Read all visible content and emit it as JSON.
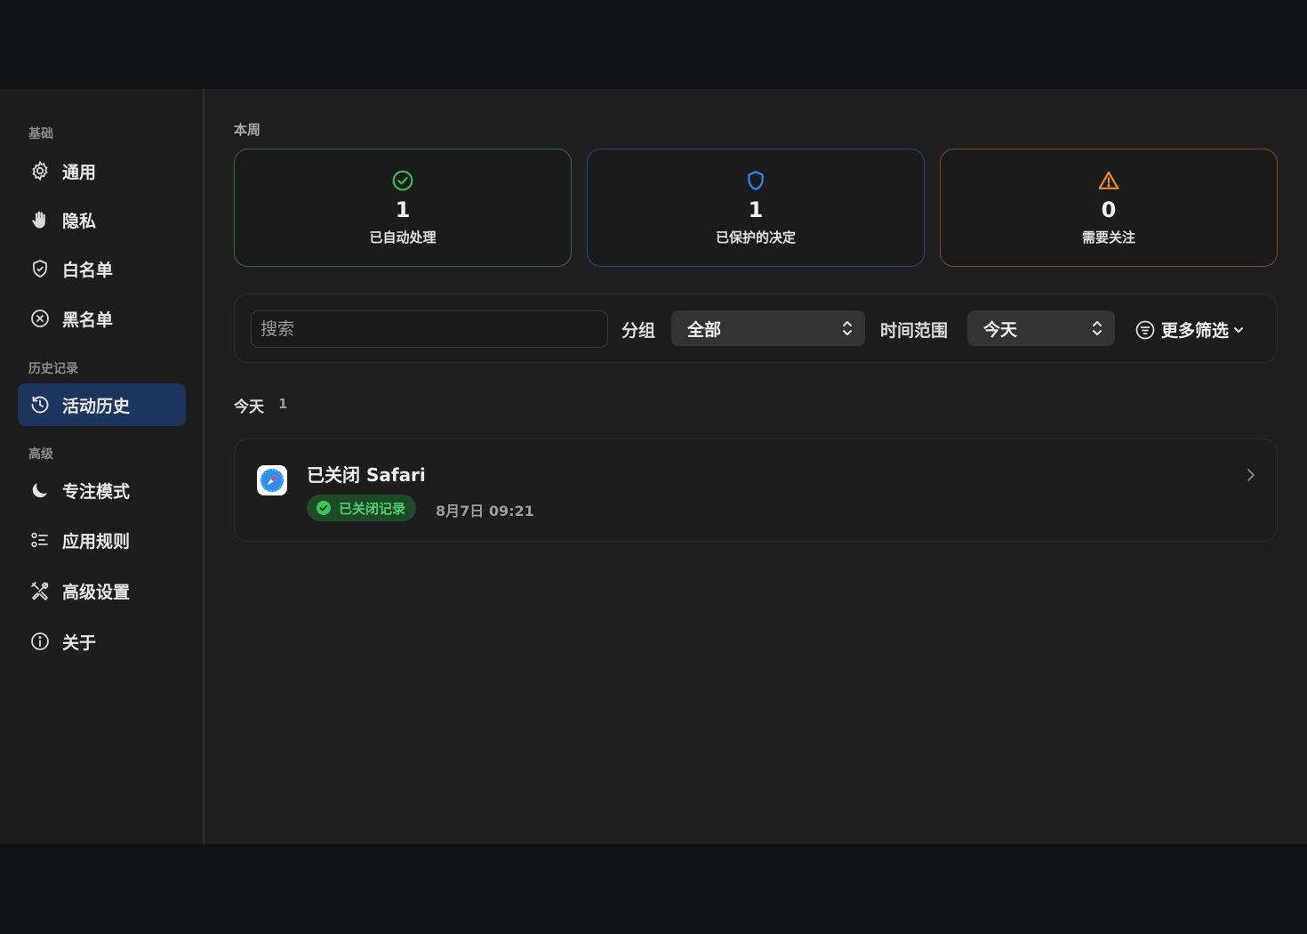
{
  "sidebar": {
    "sections": {
      "basic": "基础",
      "history": "历史记录",
      "advanced": "高级"
    },
    "items": [
      {
        "label": "通用",
        "icon": "gear-icon"
      },
      {
        "label": "隐私",
        "icon": "hand-icon"
      },
      {
        "label": "白名单",
        "icon": "shield-check-icon"
      },
      {
        "label": "黑名单",
        "icon": "x-circle-icon"
      },
      {
        "label": "活动历史",
        "icon": "history-icon",
        "active": true
      },
      {
        "label": "专注模式",
        "icon": "moon-icon"
      },
      {
        "label": "应用规则",
        "icon": "rules-list-icon"
      },
      {
        "label": "高级设置",
        "icon": "tools-icon"
      },
      {
        "label": "关于",
        "icon": "info-icon"
      }
    ]
  },
  "main": {
    "week_label": "本周",
    "stats": [
      {
        "value": "1",
        "label": "已自动处理",
        "icon": "check-circle-icon",
        "color": "#2fc152"
      },
      {
        "value": "1",
        "label": "已保护的决定",
        "icon": "shield-icon",
        "color": "#2f8cf5"
      },
      {
        "value": "0",
        "label": "需要关注",
        "icon": "warning-icon",
        "color": "#f08a2c"
      }
    ],
    "filters": {
      "search_placeholder": "搜索",
      "group_label": "分组",
      "group_value": "全部",
      "time_label": "时间范围",
      "time_value": "今天",
      "more_label": "更多筛选"
    },
    "group": {
      "title": "今天",
      "count": "1"
    },
    "records": [
      {
        "title": "已关闭 Safari",
        "badge": "已关闭记录",
        "time": "8月7日 09:21",
        "app_icon": "safari-icon"
      }
    ]
  }
}
